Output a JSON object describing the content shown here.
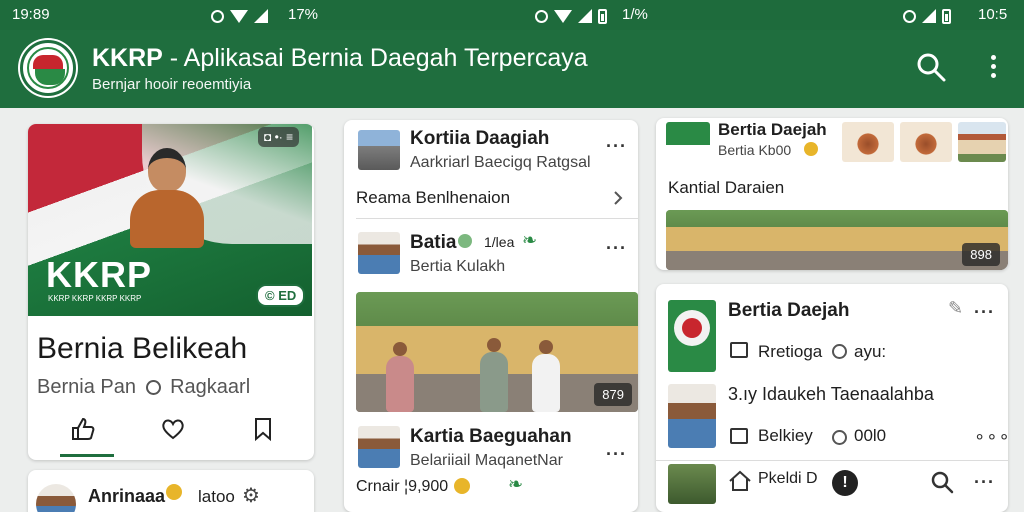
{
  "status_bar": {
    "left_time": "19:89",
    "mid_text": "17%",
    "mid2_text": "1/%",
    "right_time": "10:5"
  },
  "app_bar": {
    "title_bold": "KKRP",
    "title_rest": " - Aplikasai Bernia Daegah Terpercaya",
    "subtitle": "Bernjar hooir reoemtiyia"
  },
  "hero": {
    "badge": "◘ •· ≡",
    "brand": "KKRP",
    "brand_sub": "KKRP KKRP KKRP KKRP",
    "badge2": "© ED",
    "headline": "Bernia Belikeah",
    "meta_left": "Bernia Pan",
    "meta_right": "Ragkaarl"
  },
  "left_bottom": {
    "name": "Anrinaaa",
    "suffix": "latoo"
  },
  "mid_list": {
    "item1": {
      "title": "Kortiia Daagiah",
      "sub": "Aarkriarl Baecigq Ratgsal"
    },
    "link": "Reama Benlhenaion",
    "item2": {
      "title": "Batia",
      "tag": "1/lea",
      "sub": "Bertia Kulakh"
    },
    "photo_badge": "879",
    "item3": {
      "title": "Kartia Baeguahan",
      "sub": "Belariiail MaqanetNar"
    },
    "footer": "Crnair ¦9,900"
  },
  "right_top": {
    "title": "Bertia Daejah",
    "sub": "Bertia Kb00",
    "caption": "Kantial Daraien",
    "photo_badge": "898"
  },
  "right_list": {
    "title": "Bertia Daejah",
    "row1": "Rretioga",
    "row1_tag": "ayu:",
    "row2": "3.ıy Idaukeh Taenaalahba",
    "row3": "Belkiey",
    "row3_tag": "00l0",
    "row4": "Pkeldi D"
  },
  "colors": {
    "brand_green": "#1f6e3e",
    "accent_red": "#c8262e"
  },
  "icons": [
    "search-icon",
    "more-vert-icon",
    "thumbs-up-icon",
    "heart-icon",
    "bookmark-icon",
    "chevron-right-icon"
  ]
}
